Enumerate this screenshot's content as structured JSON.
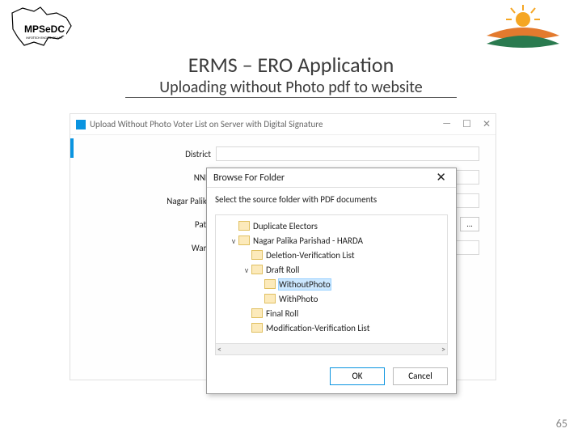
{
  "title": "ERMS – ERO Application",
  "subtitle": "Uploading without Photo pdf to website",
  "page_number": "65",
  "main_window": {
    "title": "Upload Without Photo Voter List on Server with Digital Signature",
    "controls": {
      "min": "—",
      "max": "☐",
      "close": "✕"
    },
    "labels": [
      "District",
      "NNN",
      "Nagar Palika",
      "Path",
      "Ward"
    ],
    "browse_dots": "..."
  },
  "dialog": {
    "title": "Browse For Folder",
    "hint": "Select the source folder with PDF documents",
    "close": "✕",
    "tree": [
      {
        "indent": 1,
        "expander": "",
        "label": "Duplicate Electors"
      },
      {
        "indent": 1,
        "expander": "v",
        "label": "Nagar Palika Parishad - HARDA"
      },
      {
        "indent": 2,
        "expander": "",
        "label": "Deletion-Verification List"
      },
      {
        "indent": 2,
        "expander": "v",
        "label": "Draft Roll"
      },
      {
        "indent": 3,
        "expander": "",
        "label": "WithoutPhoto",
        "selected": true
      },
      {
        "indent": 3,
        "expander": "",
        "label": "WithPhoto"
      },
      {
        "indent": 2,
        "expander": "",
        "label": "Final Roll"
      },
      {
        "indent": 2,
        "expander": "",
        "label": "Modification-Verification List"
      }
    ],
    "scroll": {
      "left": "<",
      "right": ">"
    },
    "buttons": {
      "ok": "OK",
      "cancel": "Cancel"
    }
  }
}
